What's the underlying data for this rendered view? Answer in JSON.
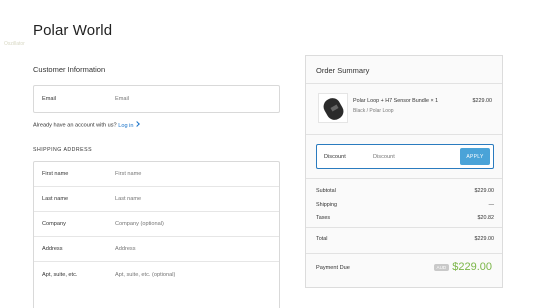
{
  "store": {
    "title": "Polar World",
    "watermark": "Oszillator"
  },
  "customer": {
    "section_title": "Customer Information",
    "email_label": "Email",
    "email_placeholder": "Email",
    "login_prompt": "Already have an account with us?",
    "login_link": "Log in"
  },
  "shipping": {
    "heading": "SHIPPING ADDRESS",
    "fields": [
      {
        "label": "First name",
        "placeholder": "First name"
      },
      {
        "label": "Last name",
        "placeholder": "Last name"
      },
      {
        "label": "Company",
        "placeholder": "Company (optional)"
      },
      {
        "label": "Address",
        "placeholder": "Address"
      },
      {
        "label": "Apt, suite, etc.",
        "placeholder": "Apt, suite, etc. (optional)"
      }
    ]
  },
  "summary": {
    "title": "Order Summary",
    "product": {
      "name": "Polar Loop + H7 Sensor Bundle",
      "qty": "× 1",
      "variant": "Black / Polar Loop",
      "price": "$229.00"
    },
    "discount": {
      "label": "Discount",
      "placeholder": "Discount",
      "button": "APPLY"
    },
    "lines": {
      "subtotal_label": "Subtotal",
      "subtotal_value": "$229.00",
      "shipping_label": "Shipping",
      "shipping_value": "—",
      "taxes_label": "Taxes",
      "taxes_value": "$20.82",
      "total_label": "Total",
      "total_value": "$229.00"
    },
    "due": {
      "label": "Payment Due",
      "currency": "AUD",
      "amount": "$229.00"
    }
  },
  "colors": {
    "accent": "#2a7bbf",
    "button": "#4aa3d8",
    "due": "#7ab547",
    "link": "#1a73c9"
  }
}
